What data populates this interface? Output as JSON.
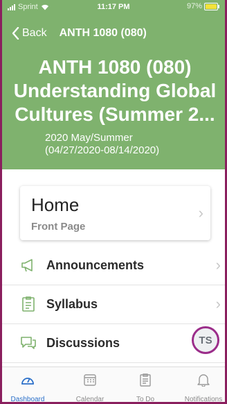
{
  "status_bar": {
    "carrier": "Sprint",
    "time": "11:17 PM",
    "battery": "97%",
    "battery_level": 0.97
  },
  "nav": {
    "back_label": "Back",
    "title": "ANTH 1080 (080)"
  },
  "course": {
    "title_line1": "ANTH 1080 (080)",
    "title_line2": "Understanding Global",
    "title_line3": "Cultures (Summer 2...",
    "term_line1": "2020 May/Summer",
    "term_line2": "(04/27/2020-08/14/2020)",
    "accent_color": "#7fb26e"
  },
  "home": {
    "title": "Home",
    "subtitle": "Front Page"
  },
  "menu": [
    {
      "label": "Announcements",
      "icon": "megaphone-icon"
    },
    {
      "label": "Syllabus",
      "icon": "syllabus-icon"
    },
    {
      "label": "Discussions",
      "icon": "discussions-icon"
    }
  ],
  "avatar": {
    "initials": "TS"
  },
  "tabs": [
    {
      "label": "Dashboard",
      "icon": "dashboard-icon",
      "active": true
    },
    {
      "label": "Calendar",
      "icon": "calendar-icon",
      "active": false
    },
    {
      "label": "To Do",
      "icon": "todo-icon",
      "active": false
    },
    {
      "label": "Notifications",
      "icon": "bell-icon",
      "active": false
    }
  ]
}
